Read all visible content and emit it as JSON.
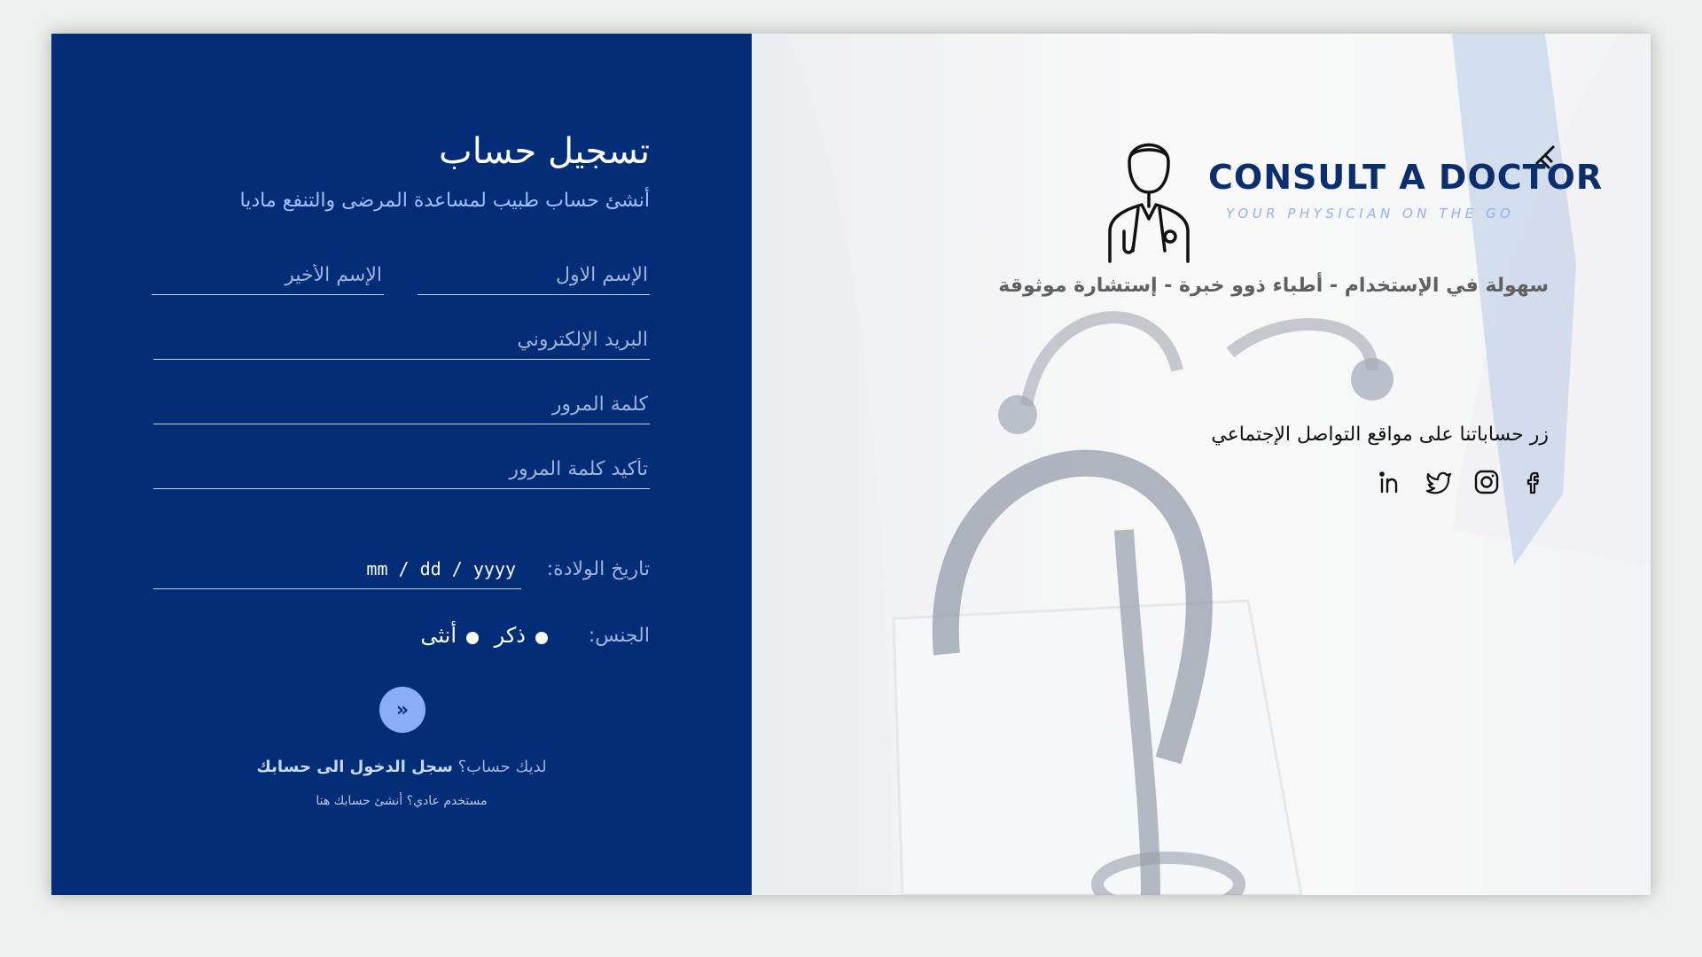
{
  "form": {
    "title": "تسجيل حساب",
    "subtitle": "أنشئ حساب طبيب لمساعدة المرضى والتنفع ماديا",
    "first_name_placeholder": "الإسم الاول",
    "last_name_placeholder": "الإسم الأخير",
    "email_placeholder": "البريد الإلكتروني",
    "password_placeholder": "كلمة المرور",
    "confirm_password_placeholder": "تأكيد كلمة المرور",
    "dob_label": "تاريخ الولادة:",
    "dob_value": "mm / dd / yyyy",
    "gender_label": "الجنس:",
    "gender_options": [
      "ذكر",
      "أنثى"
    ],
    "submit_icon": "»",
    "login_question": "لديك حساب؟",
    "login_link": "سجل الدخول الى حسابك",
    "patient_line": "مستخدم عادي؟ أنشئ حسابك هنا"
  },
  "brand": {
    "name": "CONSULT A DOCTOR",
    "tagline": "YOUR PHYSICIAN ON THE GO",
    "color": "#0b2f6e",
    "accent": "#8fb1f4"
  },
  "side": {
    "tagline": "سهولة في الإستخدام - أطباء ذوو خبرة - إستشارة موثوقة",
    "social_title": "زر حساباتنا على مواقع التواصل الإجتماعي",
    "social_icons": [
      "facebook-icon",
      "instagram-icon",
      "twitter-icon",
      "linkedin-icon"
    ]
  },
  "colors": {
    "panel": "#032d77",
    "button": "#89adf7",
    "background": "#eef0ef"
  }
}
